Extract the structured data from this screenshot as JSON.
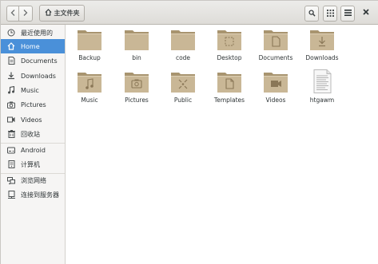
{
  "header": {
    "path_label": "主文件夹",
    "icons": {
      "back": "chevron-left-icon",
      "forward": "chevron-right-icon",
      "home": "home-icon",
      "search": "search-icon",
      "view": "grid-view-icon",
      "menu": "hamburger-menu-icon",
      "close": "close-icon"
    }
  },
  "sidebar": {
    "items": [
      {
        "label": "最近使用的",
        "icon": "clock-icon"
      },
      {
        "label": "Home",
        "icon": "home-icon",
        "active": true
      },
      {
        "label": "Documents",
        "icon": "document-icon"
      },
      {
        "label": "Downloads",
        "icon": "download-icon"
      },
      {
        "label": "Music",
        "icon": "music-icon"
      },
      {
        "label": "Pictures",
        "icon": "camera-icon"
      },
      {
        "label": "Videos",
        "icon": "video-icon"
      },
      {
        "label": "回收站",
        "icon": "trash-icon"
      },
      {
        "label": "Android",
        "icon": "drive-icon"
      },
      {
        "label": "计算机",
        "icon": "computer-icon"
      },
      {
        "label": "浏览网络",
        "icon": "network-icon"
      },
      {
        "label": "连接到服务器",
        "icon": "server-icon"
      }
    ]
  },
  "files": [
    {
      "label": "Backup",
      "icon": "folder-icon"
    },
    {
      "label": "bin",
      "icon": "folder-icon"
    },
    {
      "label": "code",
      "icon": "folder-icon"
    },
    {
      "label": "Desktop",
      "icon": "folder-desktop-icon"
    },
    {
      "label": "Documents",
      "icon": "folder-documents-icon"
    },
    {
      "label": "Downloads",
      "icon": "folder-downloads-icon"
    },
    {
      "label": "Music",
      "icon": "folder-music-icon"
    },
    {
      "label": "Pictures",
      "icon": "folder-pictures-icon"
    },
    {
      "label": "Public",
      "icon": "folder-public-icon"
    },
    {
      "label": "Templates",
      "icon": "folder-templates-icon"
    },
    {
      "label": "Videos",
      "icon": "folder-videos-icon"
    },
    {
      "label": "htgawm",
      "icon": "text-file-icon"
    }
  ],
  "colors": {
    "accent": "#4a90d9",
    "folder": "#c9b796",
    "folder_dark": "#a8946f"
  }
}
